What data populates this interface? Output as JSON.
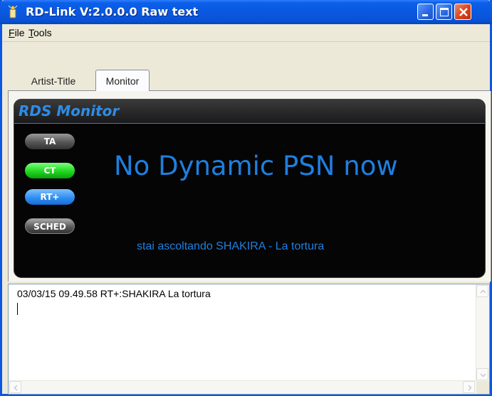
{
  "window": {
    "title": "RD-Link V:2.0.0.0 Raw text",
    "minimize_icon": "minimize-icon",
    "maximize_icon": "maximize-icon",
    "close_icon": "close-icon"
  },
  "menu": {
    "file_first": "F",
    "file_rest": "ile",
    "tools_first": "T",
    "tools_rest": "ools"
  },
  "tabs": [
    {
      "label": "Artist-Title",
      "selected": false
    },
    {
      "label": "Monitor",
      "selected": true
    }
  ],
  "rds": {
    "title": "RDS Monitor",
    "indicators": [
      {
        "label": "TA",
        "color": "#555555"
      },
      {
        "label": "CT",
        "color": "#1fd81f"
      },
      {
        "label": "RT+",
        "color": "#2f8ff2"
      },
      {
        "label": "SCHED",
        "color": "#5a5a5a"
      }
    ],
    "psn": "No Dynamic PSN now",
    "radiotext": "stai ascoltando SHAKIRA - La tortura",
    "accent_color": "#1e7fe0"
  },
  "log": {
    "line": "03/03/15 09.49.58 RT+:SHAKIRA La tortura"
  }
}
